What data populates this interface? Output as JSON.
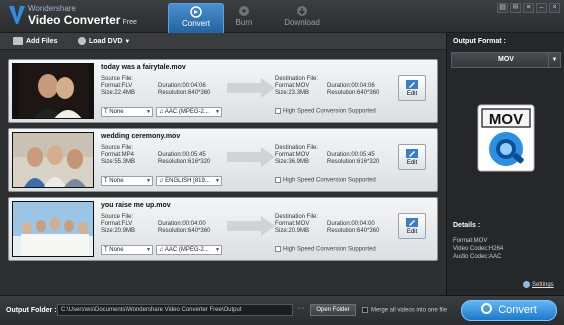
{
  "app": {
    "brand_line1": "Wondershare",
    "brand_line2": "Video Converter",
    "edition": "Free",
    "accent": "#2a7cc8"
  },
  "tabs": [
    {
      "label": "Convert",
      "icon": "convert-icon",
      "active": true
    },
    {
      "label": "Burn",
      "icon": "disc-icon",
      "active": false
    },
    {
      "label": "Download",
      "icon": "download-icon",
      "active": false
    }
  ],
  "window_buttons": [
    "cart-icon",
    "message-icon",
    "list-icon",
    "minimize-icon",
    "close-icon"
  ],
  "toolbar": {
    "add_files": "Add Files",
    "load_dvd": "Load DVD"
  },
  "files": [
    {
      "name": "today was a fairytale.mov",
      "src_label": "Source File:",
      "src_format": "Format:FLV",
      "src_duration": "Duration:00:04:06",
      "src_size": "Size:22.4MB",
      "src_resolution": "Resolution:640*360",
      "dst_label": "Destination File:",
      "dst_format": "Format:MOV",
      "dst_duration": "Duration:00:04:06",
      "dst_size": "Size:23.3MB",
      "dst_resolution": "Resolution:640*360",
      "subtitle": "None",
      "audio": "AAC (MPEG-2...",
      "hs": "High Speed Conversion Supported",
      "edit": "Edit"
    },
    {
      "name": "wedding ceremony.mov",
      "src_label": "Source File:",
      "src_format": "Format:MP4",
      "src_duration": "Duration:00:05:45",
      "src_size": "Size:55.3MB",
      "src_resolution": "Resolution:616*320",
      "dst_label": "Destination File:",
      "dst_format": "Format:MOV",
      "dst_duration": "Duration:00:05:45",
      "dst_size": "Size:36.9MB",
      "dst_resolution": "Resolution:616*320",
      "subtitle": "None",
      "audio": "ENGLISH [819...",
      "hs": "High Speed Conversion Supported",
      "edit": "Edit"
    },
    {
      "name": "you raise me up.mov",
      "src_label": "Source File:",
      "src_format": "Format:FLV",
      "src_duration": "Duration:00:04:00",
      "src_size": "Size:20.9MB",
      "src_resolution": "Resolution:640*360",
      "dst_label": "Destination File:",
      "dst_format": "Format:MOV",
      "dst_duration": "Duration:00:04:00",
      "dst_size": "Size:20.9MB",
      "dst_resolution": "Resolution:640*360",
      "subtitle": "None",
      "audio": "AAC (MPEG-2...",
      "hs": "High Speed Conversion Supported",
      "edit": "Edit"
    }
  ],
  "right_panel": {
    "output_format_label": "Output Format :",
    "format_value": "MOV",
    "format_icon_text": "MOV",
    "details_label": "Details :",
    "details": [
      "Format:MOV",
      "Video Codec:H264",
      "Audio Codec:AAC"
    ],
    "settings": "Settings"
  },
  "bottom": {
    "output_folder_label": "Output Folder :",
    "output_path": "C:\\Users\\ws\\Documents\\Wondershare Video Converter Free\\Output",
    "browse": "···",
    "open_folder": "Open Folder",
    "merge": "Merge all videos into one file",
    "convert": "Convert"
  }
}
